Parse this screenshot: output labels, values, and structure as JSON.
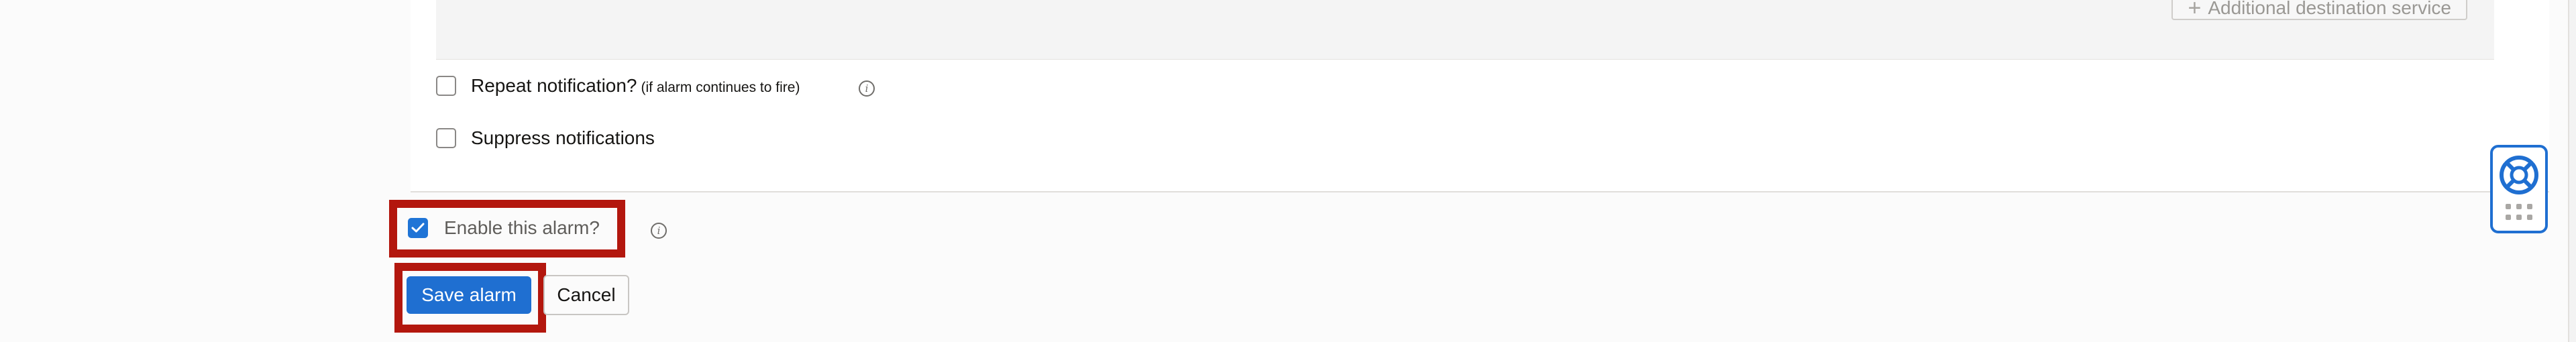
{
  "notifications": {
    "additional_destination_label": "Additional destination service",
    "repeat_notification": {
      "label": "Repeat notification?",
      "sublabel": "(if alarm continues to fire)",
      "checked": false
    },
    "suppress_notifications": {
      "label": "Suppress notifications",
      "checked": false
    }
  },
  "enable_alarm": {
    "label": "Enable this alarm?",
    "checked": true
  },
  "actions": {
    "save_label": "Save alarm",
    "cancel_label": "Cancel"
  },
  "icons": {
    "info": "i",
    "plus": "+"
  },
  "colors": {
    "primary": "#1f6fd1",
    "highlight": "#b3170e",
    "panel_bg": "#ffffff",
    "page_bg": "#fbfbfb"
  }
}
